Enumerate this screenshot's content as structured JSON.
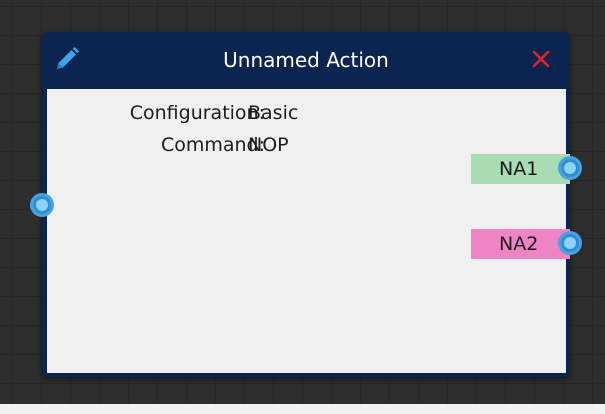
{
  "node": {
    "title": "Unnamed Action",
    "edit_icon": "pencil-icon",
    "close_icon": "close-icon",
    "close_color": "#e0252b",
    "header_color": "#0c2550"
  },
  "properties": [
    {
      "label": "Configuration:",
      "value": "Basic"
    },
    {
      "label": "Command:",
      "value": "NOP"
    }
  ],
  "outputs": [
    {
      "label": "NA1",
      "color": "#a8dcb2"
    },
    {
      "label": "NA2",
      "color": "#ef84c4"
    }
  ],
  "ports": {
    "input_icon": "input-port-icon",
    "output_icon": "output-port-icon",
    "color": "#4aa3df"
  }
}
